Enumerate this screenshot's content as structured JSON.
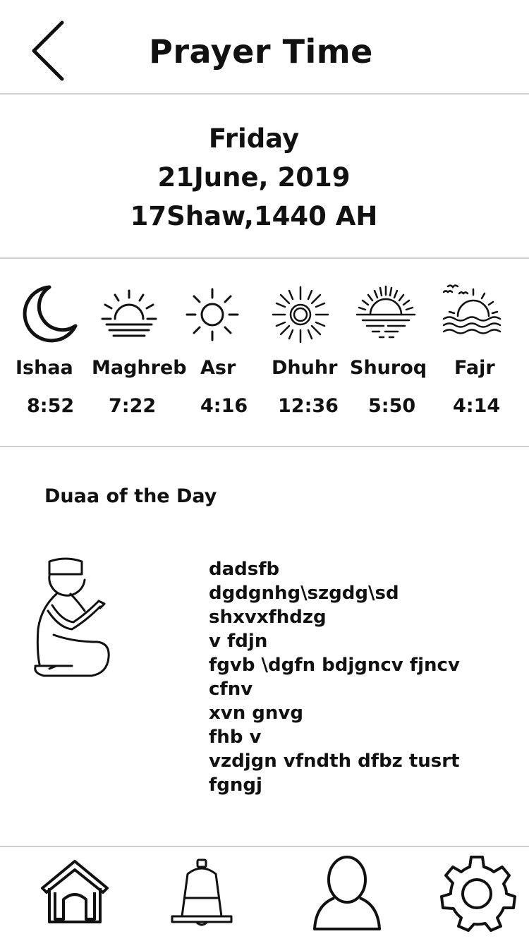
{
  "header": {
    "title": "Prayer Time"
  },
  "date": {
    "weekday": "Friday",
    "gregorian": "21June, 2019",
    "hijri": "17Shaw,1440 AH"
  },
  "prayers": [
    {
      "name": "Ishaa",
      "time": "8:52",
      "icon": "crescent-moon-icon"
    },
    {
      "name": "Maghreb",
      "time": "7:22",
      "icon": "sunset-icon"
    },
    {
      "name": "Asr",
      "time": "4:16",
      "icon": "sun-icon"
    },
    {
      "name": "Dhuhr",
      "time": "12:36",
      "icon": "bright-sun-icon"
    },
    {
      "name": "Shuroq",
      "time": "5:50",
      "icon": "sunrise-over-water-icon"
    },
    {
      "name": "Fajr",
      "time": "4:14",
      "icon": "dawn-birds-icon"
    }
  ],
  "duaa": {
    "title": "Duaa of the Day",
    "icon": "praying-man-icon",
    "lines": [
      "dadsfb",
      "dgdgnhg\\szgdg\\sd",
      "shxvxfhdzg",
      "v fdjn",
      "fgvb \\dgfn  bdjgncv fjncv",
      "cfnv",
      "xvn gnvg",
      "fhb v",
      "vzdjgn vfndth dfbz tusrt",
      "fgngj"
    ]
  },
  "nav": [
    {
      "icon": "home-icon"
    },
    {
      "icon": "bell-icon"
    },
    {
      "icon": "user-icon"
    },
    {
      "icon": "gear-icon"
    }
  ],
  "colors": {
    "ink": "#111111",
    "divider": "#cfcfcf",
    "background": "#ffffff"
  }
}
